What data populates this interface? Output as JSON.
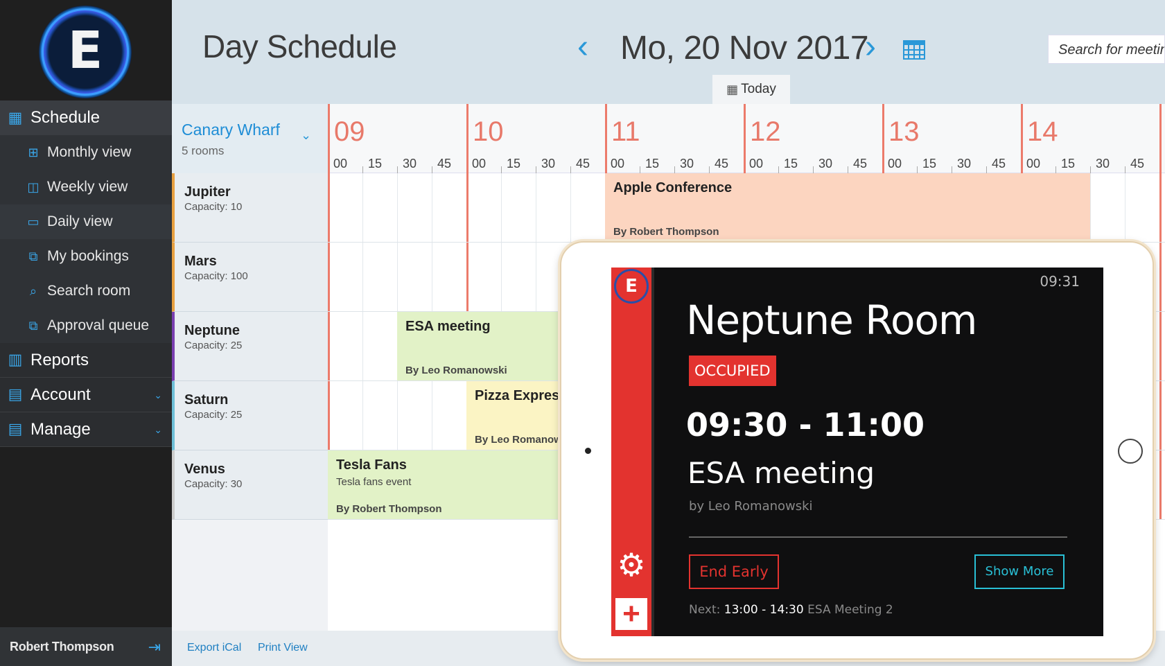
{
  "sidebar": {
    "logo_letter": "E",
    "schedule": "Schedule",
    "items": [
      {
        "label": "Monthly view",
        "icon": "monthly-calendar-icon"
      },
      {
        "label": "Weekly view",
        "icon": "weekly-calendar-icon"
      },
      {
        "label": "Daily view",
        "icon": "daily-calendar-icon"
      },
      {
        "label": "My bookings",
        "icon": "bookings-icon"
      },
      {
        "label": "Search room",
        "icon": "search-icon"
      },
      {
        "label": "Approval queue",
        "icon": "approval-icon"
      }
    ],
    "reports": "Reports",
    "account": "Account",
    "manage": "Manage",
    "user_name": "Robert Thompson"
  },
  "header": {
    "title": "Day Schedule",
    "date": "Mo, 20 Nov 2017",
    "today": "Today",
    "search_placeholder": "Search for meetin"
  },
  "location": {
    "name": "Canary Wharf",
    "rooms": "5 rooms"
  },
  "timeline": {
    "hours": [
      "09",
      "10",
      "11",
      "12",
      "13",
      "14"
    ],
    "quarters": [
      "00",
      "15",
      "30",
      "45"
    ]
  },
  "rooms": [
    {
      "name": "Jupiter",
      "capacity": "Capacity: 10",
      "color": "#e8a040"
    },
    {
      "name": "Mars",
      "capacity": "Capacity: 100",
      "color": "#e8a040"
    },
    {
      "name": "Neptune",
      "capacity": "Capacity: 25",
      "color": "#7a3fb0"
    },
    {
      "name": "Saturn",
      "capacity": "Capacity: 25",
      "color": "#6ec0d8"
    },
    {
      "name": "Venus",
      "capacity": "Capacity: 30",
      "color": "#cccccc"
    }
  ],
  "events": {
    "apple": {
      "title": "Apple Conference",
      "by": "By Robert Thompson",
      "color": "#fcd5c0"
    },
    "esa": {
      "title": "ESA meeting",
      "by": "By Leo Romanowski",
      "color": "#e2f2c7"
    },
    "pizza": {
      "title": "Pizza Express",
      "by": "By Leo Romanowski",
      "color": "#fbf4c4"
    },
    "tesla": {
      "title": "Tesla Fans",
      "subtitle": "Tesla fans event",
      "by": "By Robert Thompson",
      "color": "#e2f2c7"
    }
  },
  "footer": {
    "export": "Export iCal",
    "print": "Print View"
  },
  "tablet": {
    "logo_letter": "E",
    "clock": "09:31",
    "room": "Neptune Room",
    "status": "OCCUPIED",
    "time": "09:30 - 11:00",
    "meeting": "ESA meeting",
    "by": "by Leo Romanowski",
    "end_early": "End Early",
    "show_more": "Show More",
    "next_label": "Next:",
    "next_time": "13:00 - 14:30",
    "next_meeting": "ESA Meeting 2"
  }
}
